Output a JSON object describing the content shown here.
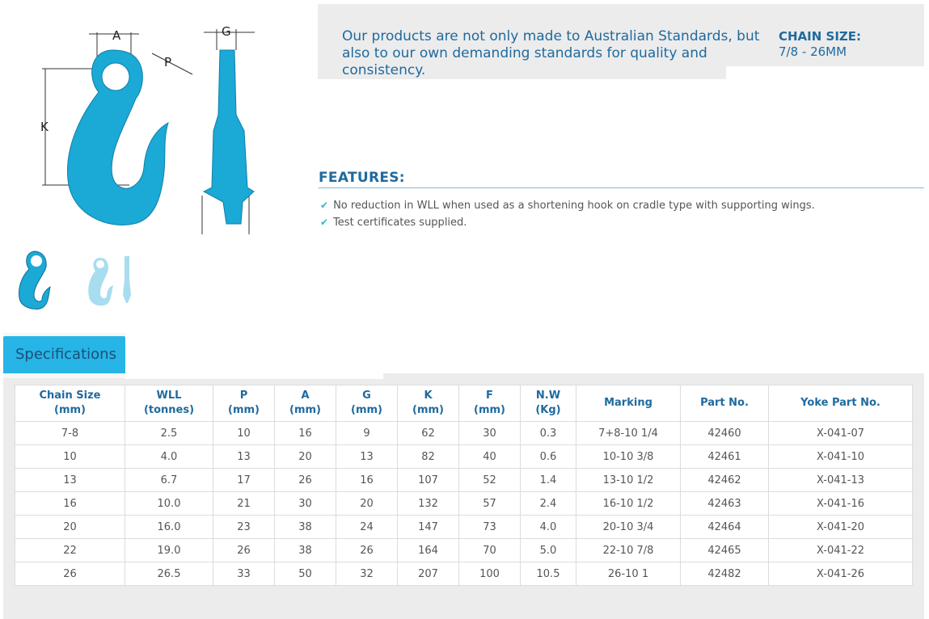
{
  "intro": {
    "text": "Our products are not only made to Australian Standards, but also to our own demanding standards for quality and consistency.",
    "chain_size_title": "CHAIN SIZE:",
    "chain_size_value": "7/8 - 26MM"
  },
  "diagram": {
    "label_a": "A",
    "label_p": "P",
    "label_k": "K",
    "label_g": "G"
  },
  "features": {
    "title": "FEATURES:",
    "items": [
      "No reduction in WLL when used as a shortening hook on cradle type with supporting wings.",
      "Test certificates supplied."
    ]
  },
  "specifications": {
    "tab_label": "Specifications",
    "headers": [
      [
        "Chain Size",
        "(mm)"
      ],
      [
        "WLL",
        "(tonnes)"
      ],
      [
        "P",
        "(mm)"
      ],
      [
        "A",
        "(mm)"
      ],
      [
        "G",
        "(mm)"
      ],
      [
        "K",
        "(mm)"
      ],
      [
        "F",
        "(mm)"
      ],
      [
        "N.W",
        "(Kg)"
      ],
      [
        "Marking",
        ""
      ],
      [
        "Part No.",
        ""
      ],
      [
        "Yoke Part No.",
        ""
      ]
    ],
    "rows": [
      [
        "7-8",
        "2.5",
        "10",
        "16",
        "9",
        "62",
        "30",
        "0.3",
        "7+8-10 1/4",
        "42460",
        "X-041-07"
      ],
      [
        "10",
        "4.0",
        "13",
        "20",
        "13",
        "82",
        "40",
        "0.6",
        "10-10 3/8",
        "42461",
        "X-041-10"
      ],
      [
        "13",
        "6.7",
        "17",
        "26",
        "16",
        "107",
        "52",
        "1.4",
        "13-10 1/2",
        "42462",
        "X-041-13"
      ],
      [
        "16",
        "10.0",
        "21",
        "30",
        "20",
        "132",
        "57",
        "2.4",
        "16-10 1/2",
        "42463",
        "X-041-16"
      ],
      [
        "20",
        "16.0",
        "23",
        "38",
        "24",
        "147",
        "73",
        "4.0",
        "20-10 3/4",
        "42464",
        "X-041-20"
      ],
      [
        "22",
        "19.0",
        "26",
        "38",
        "26",
        "164",
        "70",
        "5.0",
        "22-10 7/8",
        "42465",
        "X-041-22"
      ],
      [
        "26",
        "26.5",
        "33",
        "50",
        "32",
        "207",
        "100",
        "10.5",
        "26-10 1",
        "42482",
        "X-041-26"
      ]
    ]
  },
  "colors": {
    "accent": "#26b5e6",
    "heading": "#1f6a9e",
    "hook": "#1ba9d6"
  }
}
